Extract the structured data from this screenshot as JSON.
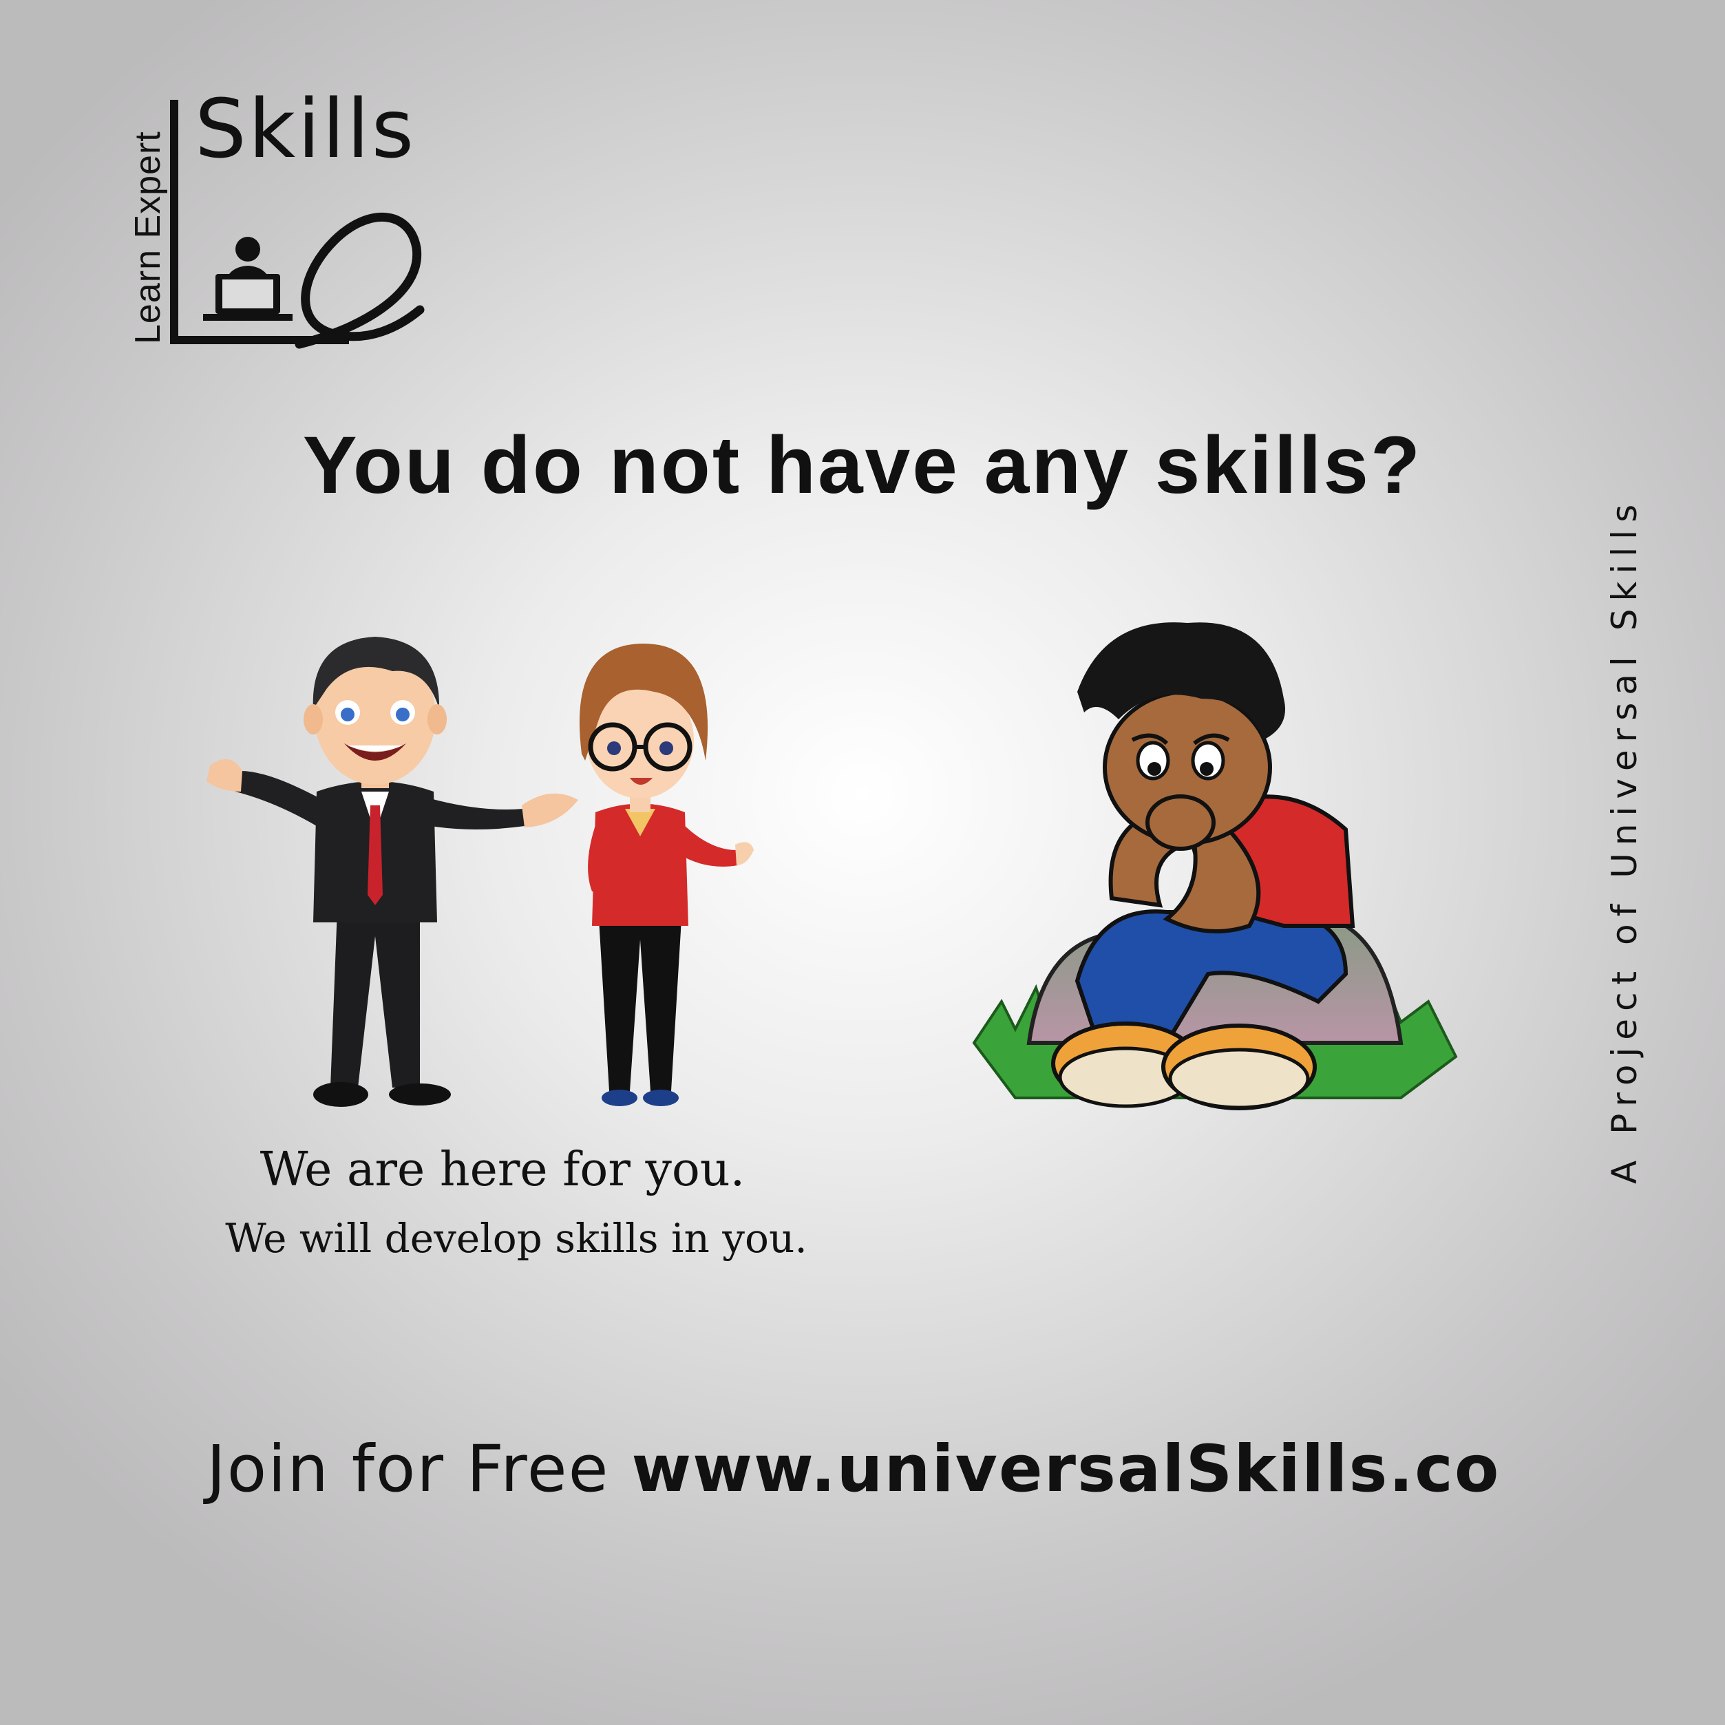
{
  "logo": {
    "vertical_text": "Learn Expert",
    "wordmark": "Skills"
  },
  "headline": "You do not have any skills?",
  "side_tag": "A Project of Universal Skills",
  "message": {
    "line1": "We are here for you.",
    "line2": "We will develop skills in you."
  },
  "cta": {
    "prefix": "Join for Free",
    "url": "www.universalSkills.co"
  },
  "colors": {
    "text": "#111111",
    "red_accent": "#d42a2a",
    "grass": "#3aa33a",
    "shirt_blue": "#1f4fa8"
  }
}
